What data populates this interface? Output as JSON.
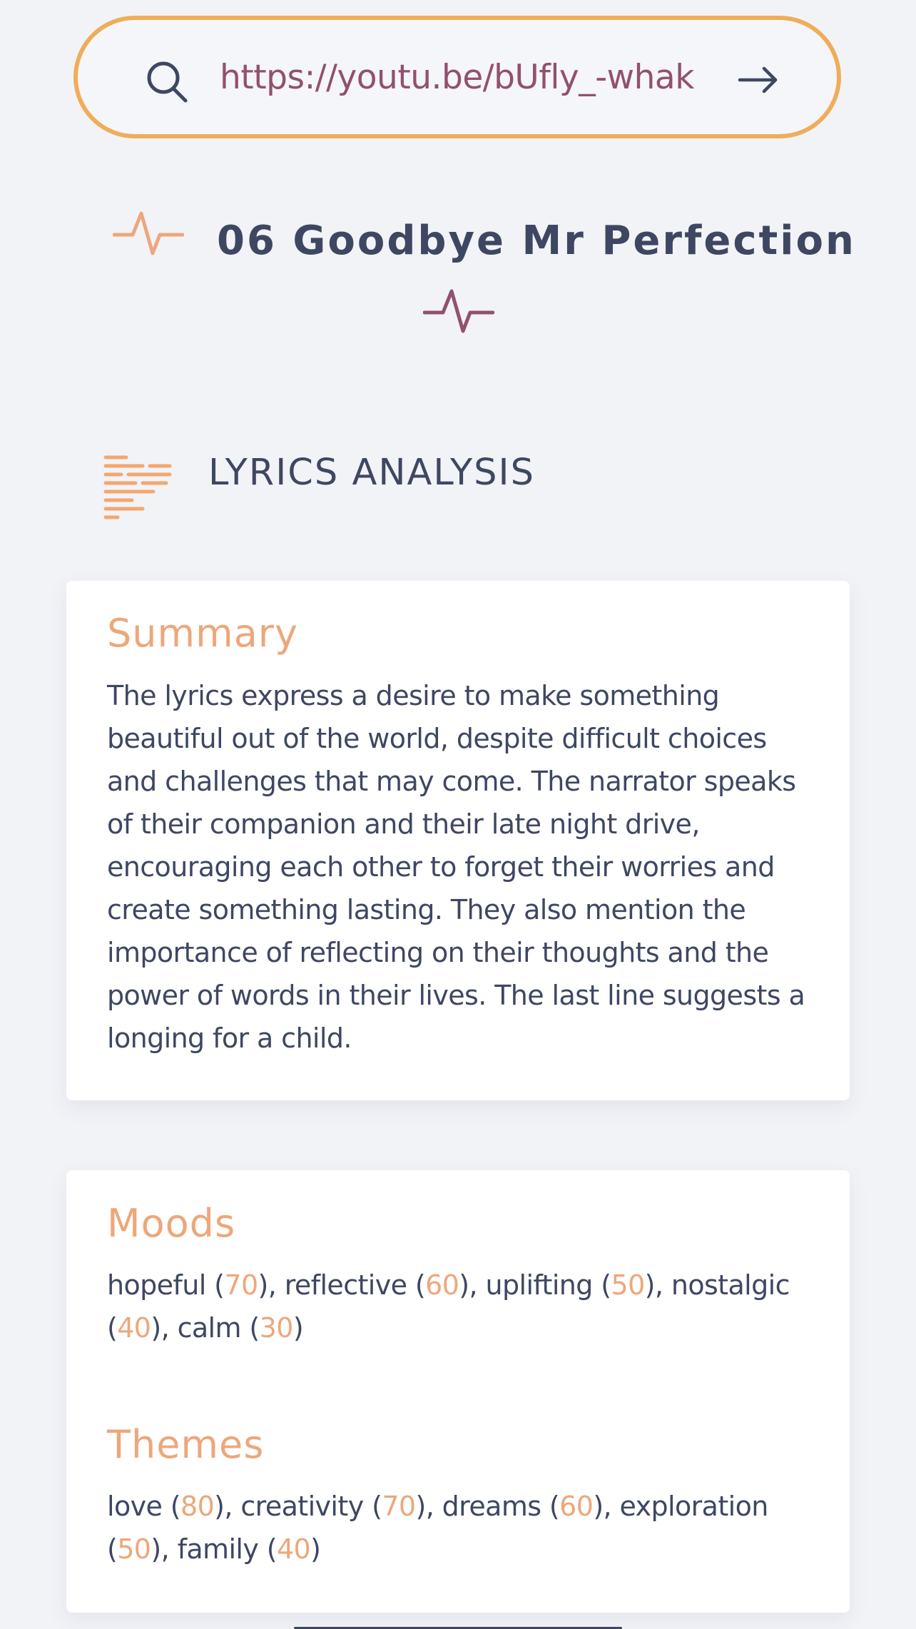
{
  "search": {
    "url": "https://youtu.be/bUfly_-whak",
    "icon": "search-icon",
    "submit_icon": "arrow-right-icon"
  },
  "song": {
    "title": "06 Goodbye Mr Perfection",
    "icon": "pulse-icon"
  },
  "section": {
    "title": "LYRICS ANALYSIS",
    "icon": "lines-icon"
  },
  "summary": {
    "heading": "Summary",
    "text": "The lyrics express a desire to make something beautiful out of the world, despite difficult choices and challenges that may come. The narrator speaks of their companion and their late night drive, encouraging each other to forget their worries and create something lasting. They also mention the importance of reflecting on their thoughts and the power of words in their lives. The last line suggests a longing for a child."
  },
  "moods": {
    "heading": "Moods",
    "items": [
      {
        "label": "hopeful",
        "score": "70"
      },
      {
        "label": "reflective",
        "score": "60"
      },
      {
        "label": "uplifting",
        "score": "50"
      },
      {
        "label": "nostalgic",
        "score": "40"
      },
      {
        "label": "calm",
        "score": "30"
      }
    ]
  },
  "themes": {
    "heading": "Themes",
    "items": [
      {
        "label": "love",
        "score": "80"
      },
      {
        "label": "creativity",
        "score": "70"
      },
      {
        "label": "dreams",
        "score": "60"
      },
      {
        "label": "exploration",
        "score": "50"
      },
      {
        "label": "family",
        "score": "40"
      }
    ]
  },
  "colors": {
    "accent_orange": "#efad5b",
    "accent_peach": "#eda77b",
    "accent_plum": "#92506f",
    "text_dark": "#3e4762",
    "background": "#f2f3f7"
  }
}
